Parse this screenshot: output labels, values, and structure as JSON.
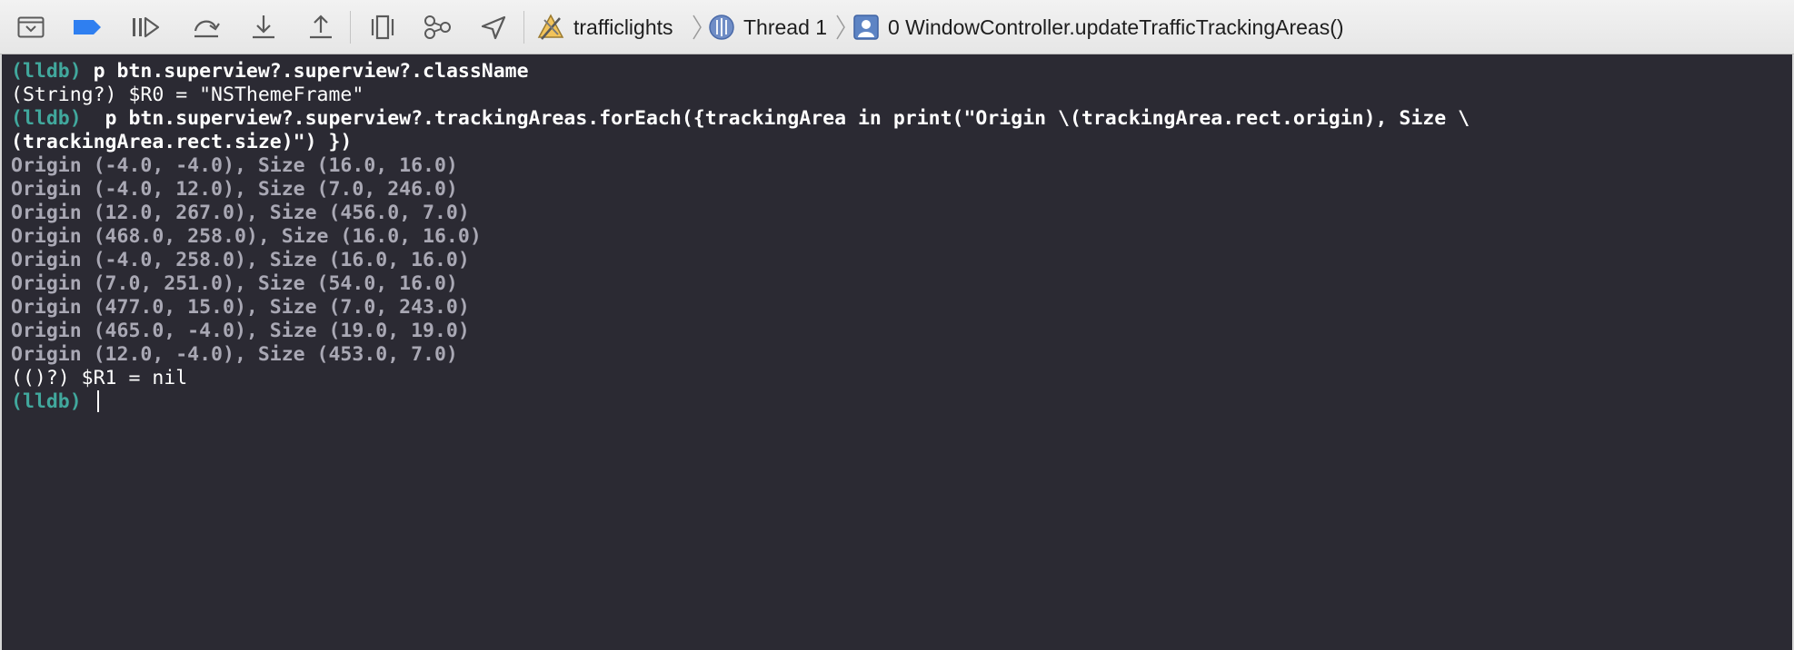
{
  "toolbar": {
    "breadcrumb": {
      "project": "trafficlights",
      "thread": "Thread 1",
      "frame": "0 WindowController.updateTrafficTrackingAreas()"
    }
  },
  "console": {
    "prompt": "(lldb)",
    "lines": [
      {
        "type": "input",
        "text": " p btn.superview?.superview?.className"
      },
      {
        "type": "result",
        "text": "(String?) $R0 = \"NSThemeFrame\""
      },
      {
        "type": "input",
        "text": "  p btn.superview?.superview?.trackingAreas.forEach({trackingArea in print(\"Origin \\(trackingArea.rect.origin), Size \\"
      },
      {
        "type": "input-cont",
        "text": "(trackingArea.rect.size)\") })"
      },
      {
        "type": "output",
        "text": "Origin (-4.0, -4.0), Size (16.0, 16.0)"
      },
      {
        "type": "output",
        "text": "Origin (-4.0, 12.0), Size (7.0, 246.0)"
      },
      {
        "type": "output",
        "text": "Origin (12.0, 267.0), Size (456.0, 7.0)"
      },
      {
        "type": "output",
        "text": "Origin (468.0, 258.0), Size (16.0, 16.0)"
      },
      {
        "type": "output",
        "text": "Origin (-4.0, 258.0), Size (16.0, 16.0)"
      },
      {
        "type": "output",
        "text": "Origin (7.0, 251.0), Size (54.0, 16.0)"
      },
      {
        "type": "output",
        "text": "Origin (477.0, 15.0), Size (7.0, 243.0)"
      },
      {
        "type": "output",
        "text": "Origin (465.0, -4.0), Size (19.0, 19.0)"
      },
      {
        "type": "output",
        "text": "Origin (12.0, -4.0), Size (453.0, 7.0)"
      },
      {
        "type": "result",
        "text": "(()?) $R1 = nil"
      },
      {
        "type": "input",
        "text": " "
      }
    ]
  },
  "icons": {
    "hide_debug_area": "hide-debug-area-icon",
    "breakpoints": "breakpoint-icon",
    "continue": "continue-icon",
    "step_over": "step-over-icon",
    "step_into": "step-into-icon",
    "step_out": "step-out-icon",
    "view_hierarchy": "view-hierarchy-icon",
    "memory_graph": "memory-graph-icon",
    "simulate_location": "location-icon"
  },
  "colors": {
    "prompt": "#41a89d",
    "console_bg": "#2b2a33",
    "output": "#a9a8b4",
    "breakpoint_blue": "#2f7ff0"
  }
}
